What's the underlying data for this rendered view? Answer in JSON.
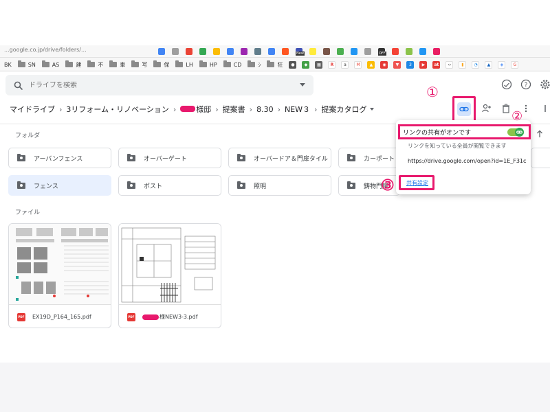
{
  "browser": {
    "url_fragment": "...google.co.jp/drive/folders/...",
    "bookmark_bar": [
      {
        "label": "BK",
        "type": "text"
      },
      {
        "label": "SN",
        "type": "folder"
      },
      {
        "label": "AS",
        "type": "folder"
      },
      {
        "label": "建",
        "type": "folder"
      },
      {
        "label": "不",
        "type": "folder"
      },
      {
        "label": "車",
        "type": "folder"
      },
      {
        "label": "写",
        "type": "folder"
      },
      {
        "label": "保",
        "type": "folder"
      },
      {
        "label": "LH",
        "type": "folder"
      },
      {
        "label": "HP",
        "type": "folder"
      },
      {
        "label": "CD",
        "type": "folder"
      },
      {
        "label": "ｼ",
        "type": "folder"
      },
      {
        "label": "狂",
        "type": "folder"
      }
    ],
    "ext_badges": [
      "New",
      "OFF",
      "3",
      "at"
    ]
  },
  "drive": {
    "search_placeholder": "ドライブを検索",
    "breadcrumb": [
      "マイドライブ",
      "3リフォーム・リノベーション",
      "様邸",
      "提案書",
      "8.30",
      "NEW３",
      "提案カタログ"
    ],
    "folders_label": "フォルダ",
    "files_label": "ファイル",
    "folders": [
      {
        "name": "アーバンフェンス",
        "selected": false
      },
      {
        "name": "オーバーゲート",
        "selected": false
      },
      {
        "name": "オーバードア＆門扉タイル",
        "selected": false
      },
      {
        "name": "カーポート",
        "selected": false
      },
      {
        "name": "フェンス",
        "selected": true
      },
      {
        "name": "ポスト",
        "selected": false
      },
      {
        "name": "照明",
        "selected": false
      },
      {
        "name": "鋳物門扉",
        "selected": false
      }
    ],
    "files": [
      {
        "name": "EX19D_P164_165.pdf",
        "type": "PDF"
      },
      {
        "name": "様NEW3-3.pdf",
        "type": "PDF"
      }
    ]
  },
  "share_popup": {
    "status": "リンクの共有がオンです",
    "description": "リンクを知っている全員が閲覧できます",
    "url": "https://drive.google.com/open?id=1E_F31c",
    "settings_link": "共有設定"
  },
  "annotations": [
    "①",
    "②",
    "③"
  ],
  "colors": {
    "accent_highlight": "#e8196d",
    "link_blue": "#1a73e8",
    "selected_folder": "#e8f0fe",
    "toggle_green": "#34a853"
  }
}
